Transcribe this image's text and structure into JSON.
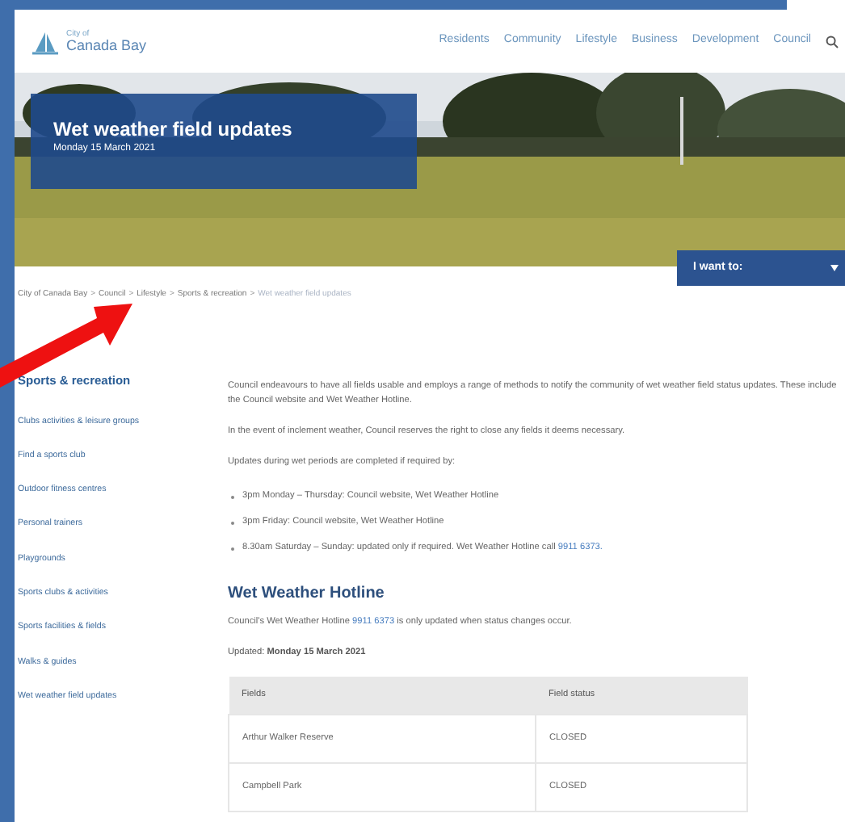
{
  "header": {
    "logo": {
      "line_1": "City of",
      "line_2": "Canada Bay"
    },
    "nav": [
      "Residents",
      "Community",
      "Lifestyle",
      "Business",
      "Development",
      "Council"
    ]
  },
  "hero": {
    "kind": "picture",
    "title": "Wet weather field updates",
    "date": "Monday 15 March 2021",
    "menu_button": "I want to:"
  },
  "breadcrumb_separator": ">",
  "breadcrumb": [
    {
      "label": "City of Canada Bay",
      "current": false
    },
    {
      "label": "Council",
      "current": false
    },
    {
      "label": "Lifestyle",
      "current": false
    },
    {
      "label": "Sports & recreation",
      "current": false
    },
    {
      "label": "Wet weather field updates",
      "current": true
    }
  ],
  "sidebar": {
    "heading": "Sports & recreation",
    "items": [
      "Clubs activities & leisure groups",
      "Find a sports club",
      "Outdoor fitness centres",
      "Personal trainers",
      "Playgrounds",
      "Sports clubs & activities",
      "Sports facilities & fields",
      "Walks & guides",
      "Wet weather field updates"
    ]
  },
  "content": {
    "paragraphs": [
      "Council endeavours to have all fields usable and employs a range of methods to notify the community of wet weather field status updates. These include the Council website and Wet Weather Hotline.",
      "In the event of inclement weather, Council reserves the right to close any fields it deems necessary.",
      "Updates during wet periods are completed if required by:"
    ],
    "bullets": [
      {
        "text": "3pm Monday – Thursday: Council website, Wet Weather Hotline"
      },
      {
        "text": "3pm Friday: Council website, Wet Weather Hotline"
      },
      {
        "text": "8.30am Saturday – Sunday: updated only if required. Wet Weather Hotline call",
        "link": "9911 6373."
      }
    ],
    "hotline_heading": "Wet Weather Hotline",
    "hotline_text": {
      "before": "Council's Wet Weather Hotline",
      "link": "9911 6373",
      "after": "is only updated when status changes occur."
    },
    "updated": "Updated: **Monday 15 March 2021**",
    "table": {
      "columns": [
        "Fields",
        "Field status"
      ],
      "rows": [
        [
          "Arthur Walker Reserve",
          "CLOSED"
        ],
        [
          "Campbell Park",
          "CLOSED"
        ]
      ]
    }
  },
  "annotation": {
    "kind": "arrow"
  }
}
